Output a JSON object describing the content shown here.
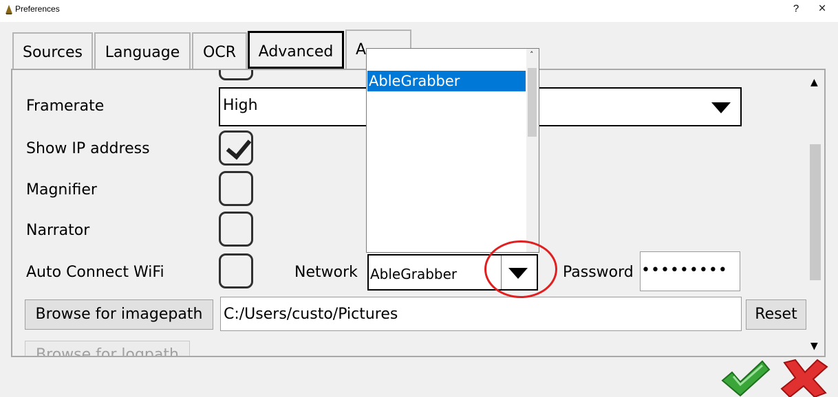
{
  "window": {
    "title": "Preferences",
    "help_label": "?",
    "close_label": "×"
  },
  "tabs": [
    {
      "label": "Sources"
    },
    {
      "label": "Language"
    },
    {
      "label": "OCR"
    },
    {
      "label": "Advanced",
      "selected": true
    },
    {
      "label": "A"
    }
  ],
  "advanced": {
    "framerate": {
      "label": "Framerate",
      "value": "High"
    },
    "show_ip": {
      "label": "Show IP address",
      "checked": true
    },
    "magnifier": {
      "label": "Magnifier",
      "checked": false
    },
    "narrator": {
      "label": "Narrator",
      "checked": false
    },
    "auto_wifi": {
      "label": "Auto Connect WiFi",
      "checked": false
    },
    "network": {
      "label": "Network",
      "value": "AbleGrabber"
    },
    "password": {
      "label": "Password",
      "value": "•••••••••"
    },
    "imagepath": {
      "button_label": "Browse for imagepath",
      "value": "C:/Users/custo/Pictures",
      "reset_label": "Reset"
    },
    "logpath": {
      "button_label": "Browse for logpath"
    }
  },
  "network_dropdown": {
    "options": [
      "AbleGrabber"
    ],
    "selected": "AbleGrabber"
  },
  "colors": {
    "selection": "#0078d7",
    "highlight_circle": "#e02020",
    "ok_green": "#3aa63a",
    "cancel_red": "#e03030"
  },
  "icons": {
    "ok": "green-checkmark-icon",
    "cancel": "red-x-icon"
  }
}
